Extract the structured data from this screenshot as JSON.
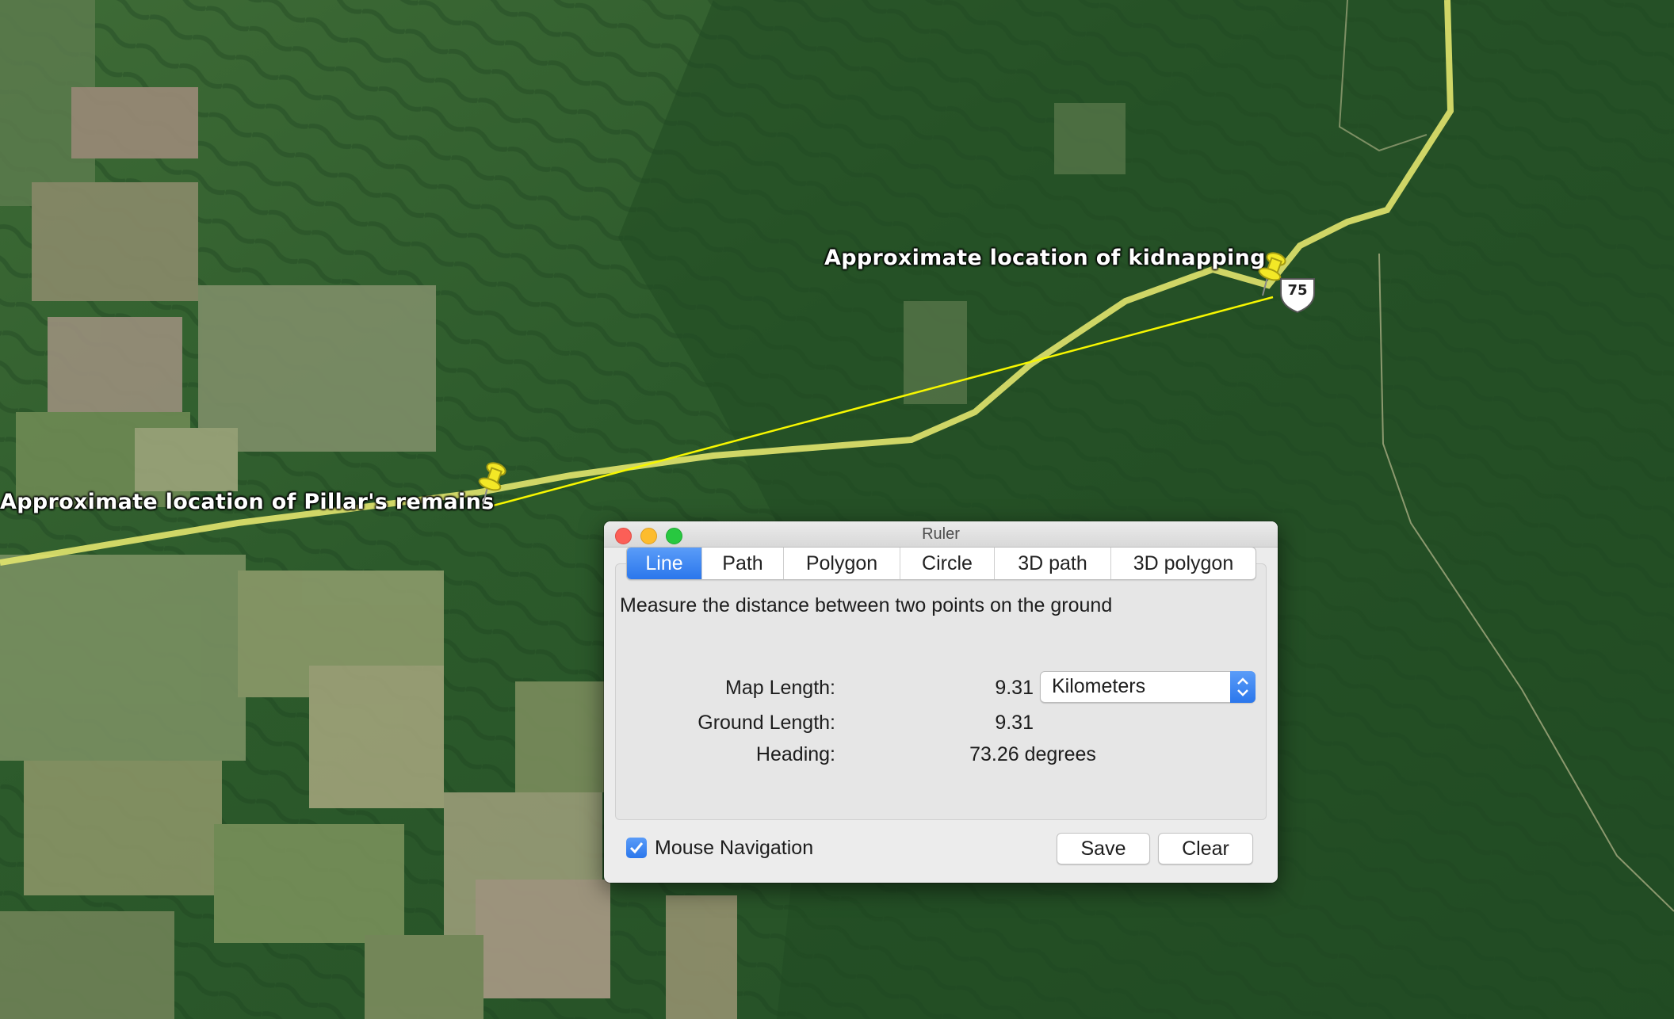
{
  "map": {
    "placemarks": [
      {
        "label": "Approximate location of kidnapping"
      },
      {
        "label": "Approximate location of Pillar's remains"
      }
    ],
    "road_shield": "75",
    "colors": {
      "path": "#f7f700",
      "road": "#e9e873",
      "pin": "#f3e826"
    }
  },
  "ruler": {
    "title": "Ruler",
    "tabs": [
      {
        "label": "Line",
        "active": true
      },
      {
        "label": "Path",
        "active": false
      },
      {
        "label": "Polygon",
        "active": false
      },
      {
        "label": "Circle",
        "active": false
      },
      {
        "label": "3D path",
        "active": false
      },
      {
        "label": "3D polygon",
        "active": false
      }
    ],
    "description": "Measure the distance between two points on the ground",
    "map_length_label": "Map Length:",
    "map_length_value": "9.31",
    "ground_length_label": "Ground Length:",
    "ground_length_value": "9.31",
    "heading_label": "Heading:",
    "heading_value": "73.26 degrees",
    "unit": "Kilometers",
    "mouse_navigation_label": "Mouse Navigation",
    "mouse_navigation_checked": true,
    "save_label": "Save",
    "clear_label": "Clear"
  }
}
